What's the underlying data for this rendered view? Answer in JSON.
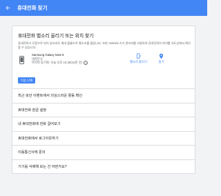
{
  "appbar": {
    "title": "휴대전화 찾기"
  },
  "card": {
    "title": "휴대전화 벨소리 울리기 또는 위치 찾기",
    "description": "휴대전화가 무음으로 되어 있더라도 최대 볼륨으로 벨소리를 울립니다. 또한 Android 기기 관리자를 사용하여 휴대전화의 위치를 지도상에서 확인할 수 있습니다.",
    "device": {
      "name": "Samsung Galaxy Note 8",
      "network": "대한민국",
      "last_sync": "마지막 동기화: 오늘 오후 10:30(15분 전)"
    },
    "actions": {
      "ring": "벨소리 울리기",
      "find": "찾기"
    },
    "next_button": "다음 단계"
  },
  "list": [
    "최근 보안 이벤트에서 의심스러운 활동 확인",
    "휴대전화 잠금 설정",
    "내 휴대전화에 전화 걸어보기",
    "휴대전화에서 로그아웃하기",
    "이동통신사에 문의",
    "기기를 삭제해 보는 건 어떤가요?"
  ],
  "colors": {
    "accent": "#4285f4",
    "background": "#f1f3f4",
    "card": "#ffffff",
    "divider": "#dadce0"
  },
  "icons": {
    "back": "arrow-back-icon",
    "phone": "smartphone-icon",
    "help": "help-circle-icon",
    "ring": "phone-ring-icon",
    "find": "location-pin-icon"
  }
}
